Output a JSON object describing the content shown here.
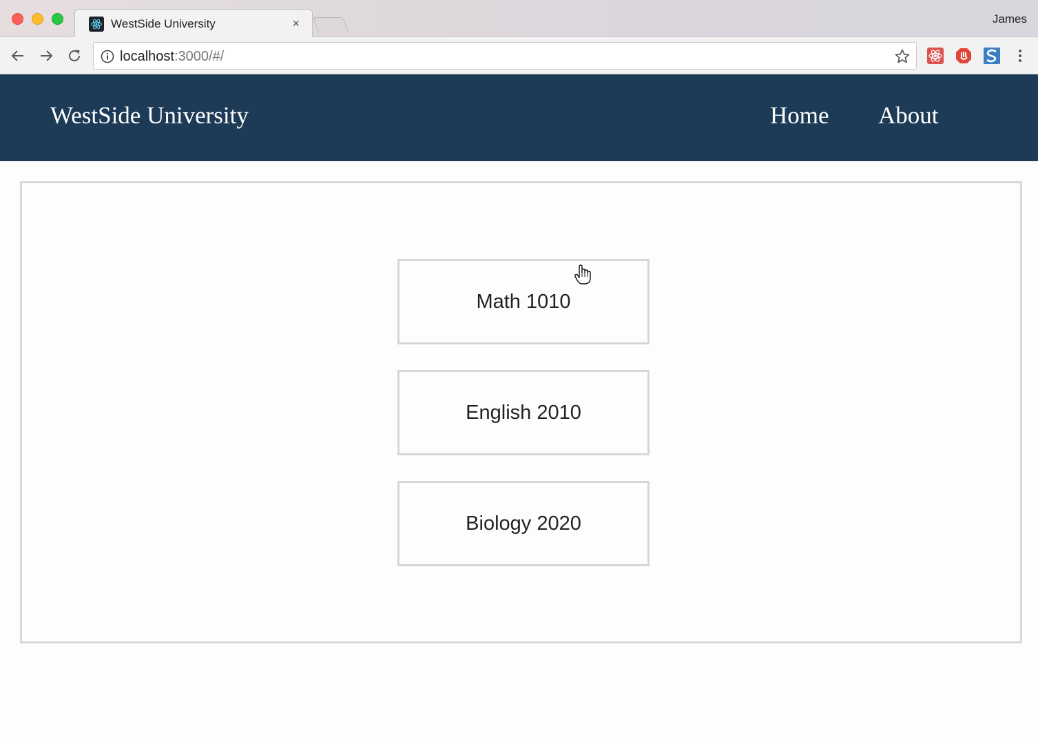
{
  "browser": {
    "tab_title": "WestSide University",
    "tab_close": "×",
    "profile_name": "James",
    "url_host": "localhost",
    "url_rest": ":3000/#/"
  },
  "site": {
    "brand": "WestSide University",
    "nav": [
      {
        "label": "Home"
      },
      {
        "label": "About"
      }
    ],
    "header_color": "#1d3a56"
  },
  "courses": [
    {
      "label": "Math 1010"
    },
    {
      "label": "English 2010"
    },
    {
      "label": "Biology 2020"
    }
  ]
}
